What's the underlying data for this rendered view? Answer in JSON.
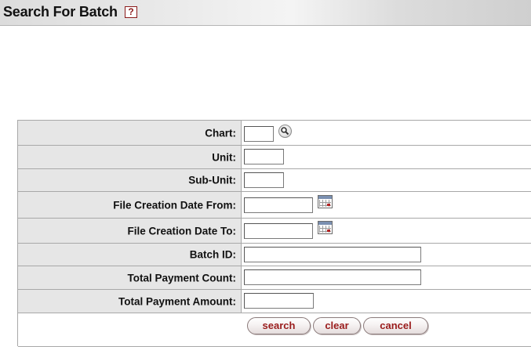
{
  "header": {
    "title": "Search For Batch",
    "help_glyph": "?",
    "help_icon": "help-icon"
  },
  "form": {
    "rows": [
      {
        "label": "Chart:",
        "value": "",
        "icon": "lookup-icon"
      },
      {
        "label": "Unit:",
        "value": ""
      },
      {
        "label": "Sub-Unit:",
        "value": ""
      },
      {
        "label": "File Creation Date From:",
        "value": "",
        "icon": "calendar-icon"
      },
      {
        "label": "File Creation Date To:",
        "value": "",
        "icon": "calendar-icon"
      },
      {
        "label": "Batch ID:",
        "value": ""
      },
      {
        "label": "Total Payment Count:",
        "value": ""
      },
      {
        "label": "Total Payment Amount:",
        "value": ""
      }
    ]
  },
  "buttons": {
    "search": "search",
    "clear": "clear",
    "cancel": "cancel"
  },
  "colors": {
    "label_bg": "#e6e6e6",
    "button_text": "#9a1c1c",
    "help_border": "#8b1a1a"
  }
}
